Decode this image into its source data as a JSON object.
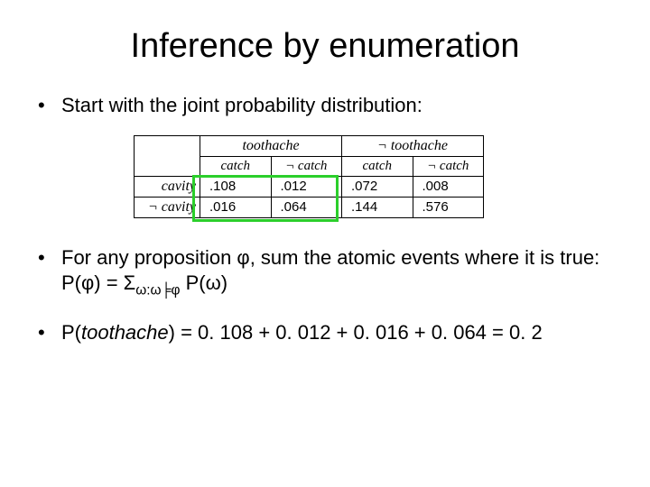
{
  "title": "Inference by enumeration",
  "bullets": {
    "b1": "Start with the joint probability distribution:",
    "b2_pre": "For any proposition φ, sum the atomic events where it is true: P(φ) = Σ",
    "b2_sub": "ω:ω╞φ",
    "b2_post": " P(ω)",
    "b3_pre": "P(",
    "b3_ital": "toothache",
    "b3_post": ") = 0. 108 + 0. 012 + 0. 016 + 0. 064 = 0. 2"
  },
  "table": {
    "col_head": {
      "toothache": "toothache",
      "not_toothache": "¬ toothache"
    },
    "sub_head": {
      "catch": "catch",
      "not_catch": "¬ catch"
    },
    "row_head": {
      "cavity": "cavity",
      "not_cavity": "¬ cavity"
    },
    "vals": {
      "r1c1": ".108",
      "r1c2": ".012",
      "r1c3": ".072",
      "r1c4": ".008",
      "r2c1": ".016",
      "r2c2": ".064",
      "r2c3": ".144",
      "r2c4": ".576"
    }
  },
  "chart_data": {
    "type": "table",
    "title": "Joint probability distribution",
    "columns": [
      "toothache ∧ catch",
      "toothache ∧ ¬catch",
      "¬toothache ∧ catch",
      "¬toothache ∧ ¬catch"
    ],
    "rows": [
      {
        "label": "cavity",
        "values": [
          0.108,
          0.012,
          0.072,
          0.008
        ]
      },
      {
        "label": "¬cavity",
        "values": [
          0.016,
          0.064,
          0.144,
          0.576
        ]
      }
    ],
    "highlight": {
      "columns": [
        0,
        1
      ],
      "label": "toothache"
    }
  }
}
